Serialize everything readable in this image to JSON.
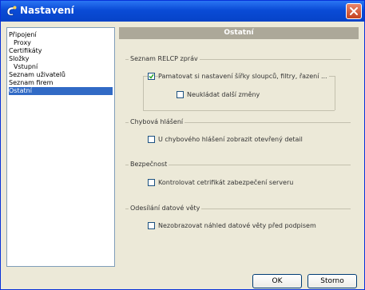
{
  "window": {
    "title": "Nastavení",
    "close_icon": "close-icon"
  },
  "nav": {
    "items": [
      {
        "label": "Připojení",
        "indent": false,
        "selected": false
      },
      {
        "label": "Proxy",
        "indent": true,
        "selected": false
      },
      {
        "label": "Certifikáty",
        "indent": false,
        "selected": false
      },
      {
        "label": "Složky",
        "indent": false,
        "selected": false
      },
      {
        "label": "Vstupní",
        "indent": true,
        "selected": false
      },
      {
        "label": "Seznam uživatelů",
        "indent": false,
        "selected": false
      },
      {
        "label": "Seznam firem",
        "indent": false,
        "selected": false
      },
      {
        "label": "Ostatní",
        "indent": false,
        "selected": true
      }
    ]
  },
  "panel": {
    "header": "Ostatní",
    "groups": {
      "relcp": {
        "title": "Seznam RELCP zpráv",
        "remember_label": "Pamatovat si nastavení šířky sloupců, filtry, řazení ...",
        "remember_checked": true,
        "no_save_label": "Neukládat další změny",
        "no_save_checked": false
      },
      "errors": {
        "title": "Chybová hlášení",
        "detail_label": "U chybového hlášení zobrazit otevřený detail",
        "detail_checked": false
      },
      "security": {
        "title": "Bezpečnost",
        "cert_label": "Kontrolovat cetrifikát zabezpečení serveru",
        "cert_checked": false
      },
      "sending": {
        "title": "Odesílání datové věty",
        "preview_label": "Nezobrazovat náhled datové věty před podpisem",
        "preview_checked": false
      }
    }
  },
  "buttons": {
    "ok": "OK",
    "cancel": "Storno"
  }
}
